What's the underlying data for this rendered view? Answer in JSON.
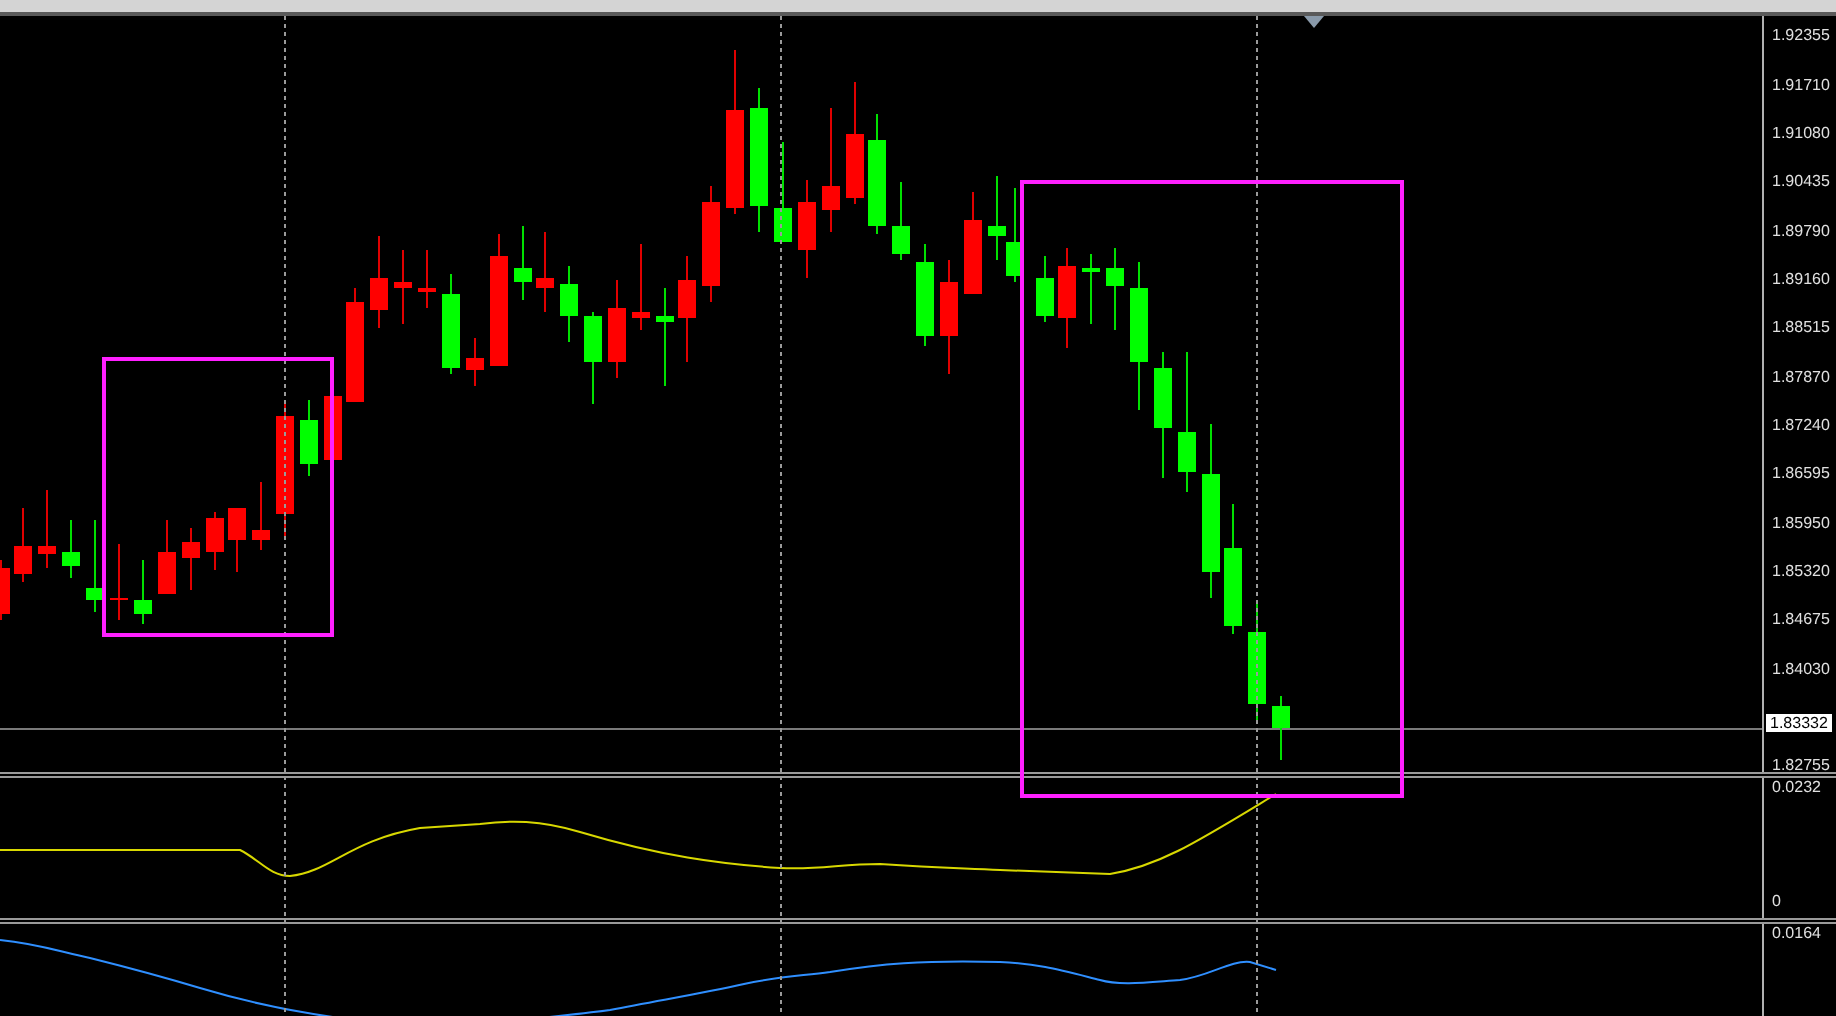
{
  "price_axis": {
    "labels": [
      "1.92355",
      "1.91710",
      "1.91080",
      "1.90435",
      "1.89790",
      "1.89160",
      "1.88515",
      "1.87870",
      "1.87240",
      "1.86595",
      "1.85950",
      "1.85320",
      "1.84675",
      "1.84030",
      "1.82755"
    ]
  },
  "current_price": "1.83332",
  "indicator_1": {
    "axis_labels": [
      "0.0232",
      "0"
    ]
  },
  "indicator_2": {
    "axis_labels": [
      "0.0164"
    ]
  }
}
